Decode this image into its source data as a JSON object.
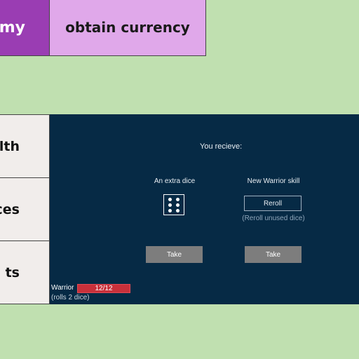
{
  "tabs": {
    "enemy_label": "emy",
    "currency_label": "obtain currency"
  },
  "side_tabs": [
    {
      "label": "lth"
    },
    {
      "label": "ces"
    },
    {
      "label": "ts"
    }
  ],
  "reward": {
    "header": "You recieve:",
    "option_dice": {
      "title": "An extra dice",
      "die_icon": "die-six-icon",
      "take_label": "Take"
    },
    "option_skill": {
      "title": "New Warrior skill",
      "skill_name": "Reroll",
      "skill_desc": "(Reroll unused dice)",
      "take_label": "Take"
    }
  },
  "hero": {
    "name": "Warrior",
    "hp": "12/12",
    "hp_fraction": 1.0,
    "subtitle": "(rolls 2 dice)"
  },
  "colors": {
    "background": "#c0e0b0",
    "panel": "#062a45",
    "enemy_tab": "#9a3db3",
    "currency_tab": "#e0a8ea",
    "hp_bar": "#c8303a",
    "take_button": "#7d7d7d"
  }
}
